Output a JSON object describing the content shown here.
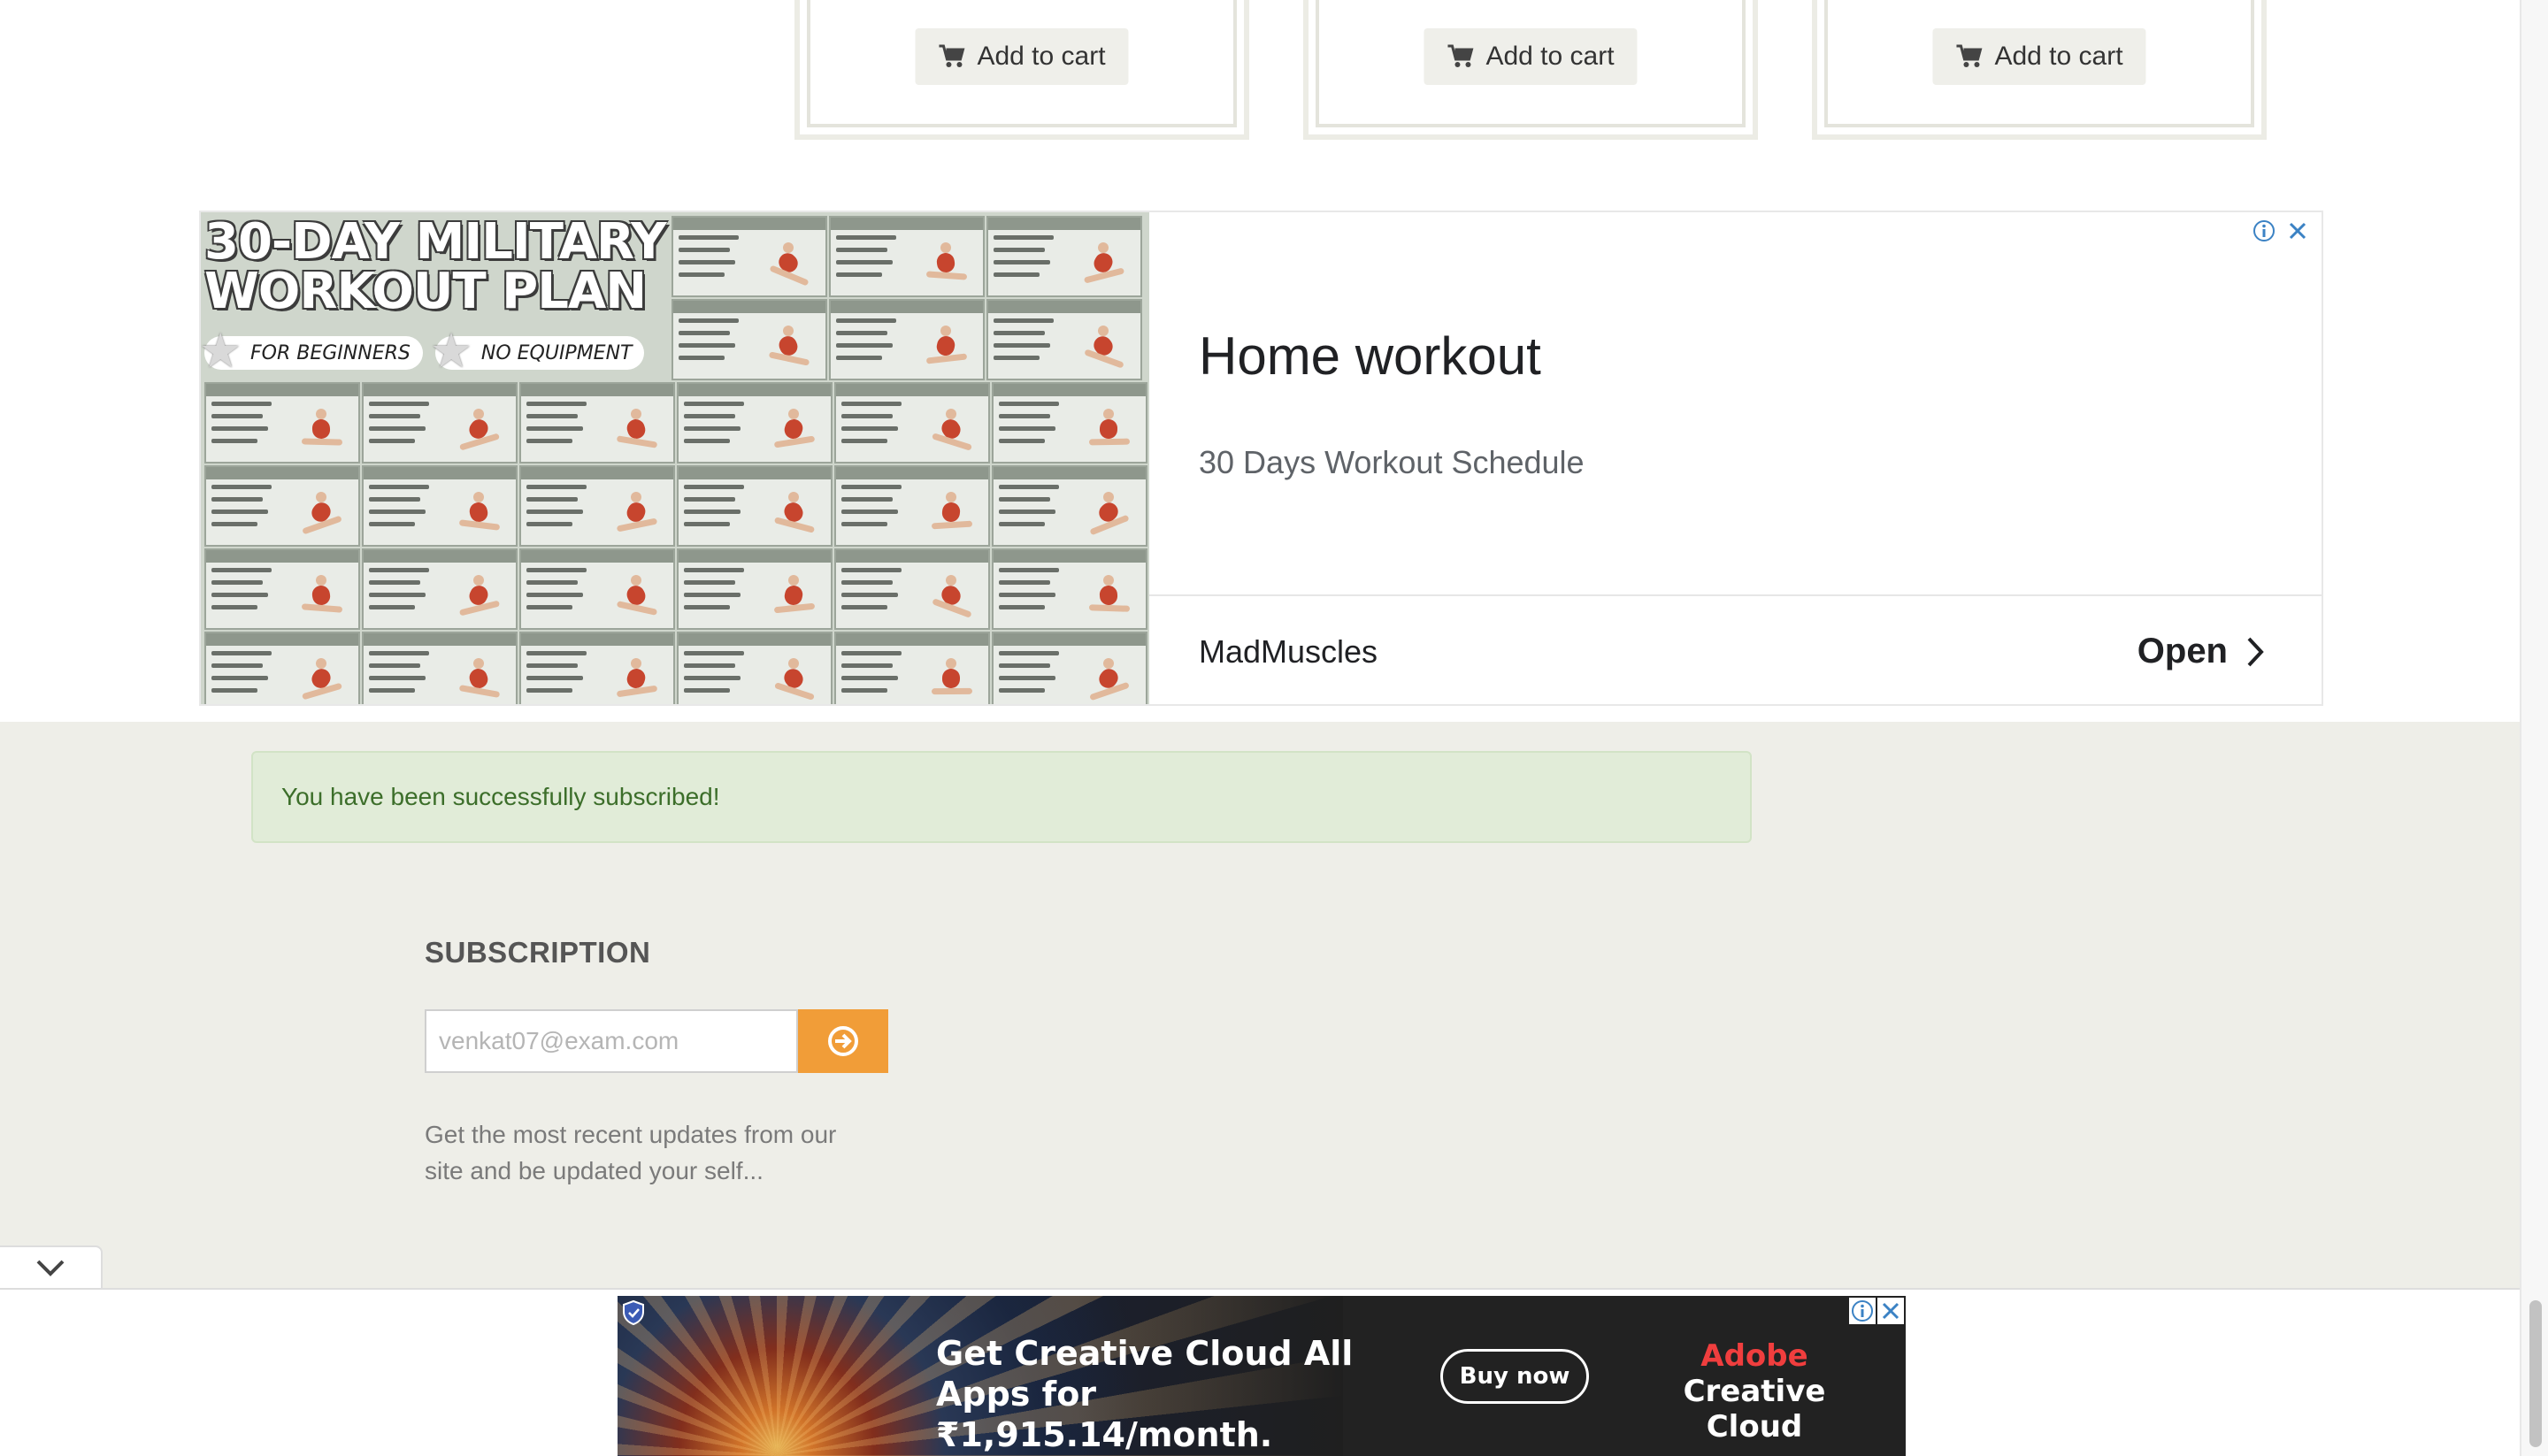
{
  "products": {
    "cards": [
      {
        "add_to_cart": "Add to cart"
      },
      {
        "add_to_cart": "Add to cart"
      },
      {
        "add_to_cart": "Add to cart"
      }
    ]
  },
  "ad": {
    "image": {
      "title_line1": "30-DAY MILITARY",
      "title_line2": "WORKOUT PLAN",
      "tag1": "FOR BEGINNERS",
      "tag2": "NO EQUIPMENT"
    },
    "headline": "Home workout",
    "subtitle": "30 Days Workout Schedule",
    "advertiser": "MadMuscles",
    "cta": "Open"
  },
  "footer": {
    "alert": "You have been successfully subscribed!",
    "heading": "SUBSCRIPTION",
    "email_placeholder": "venkat07@exam.com",
    "description": "Get the most recent updates from our site and be updated your self..."
  },
  "bottom_ad": {
    "headline": "Get Creative Cloud All Apps for ₹1,915.14/month.",
    "button": "Buy now",
    "brand_line1": "Adobe",
    "brand_line2": "Creative Cloud"
  },
  "colors": {
    "accent_orange": "#f19d38",
    "success_bg": "#e1ecd8",
    "success_text": "#3c6e2a",
    "footer_bg": "#eeeee8",
    "adobe_red": "#f03e3e"
  }
}
